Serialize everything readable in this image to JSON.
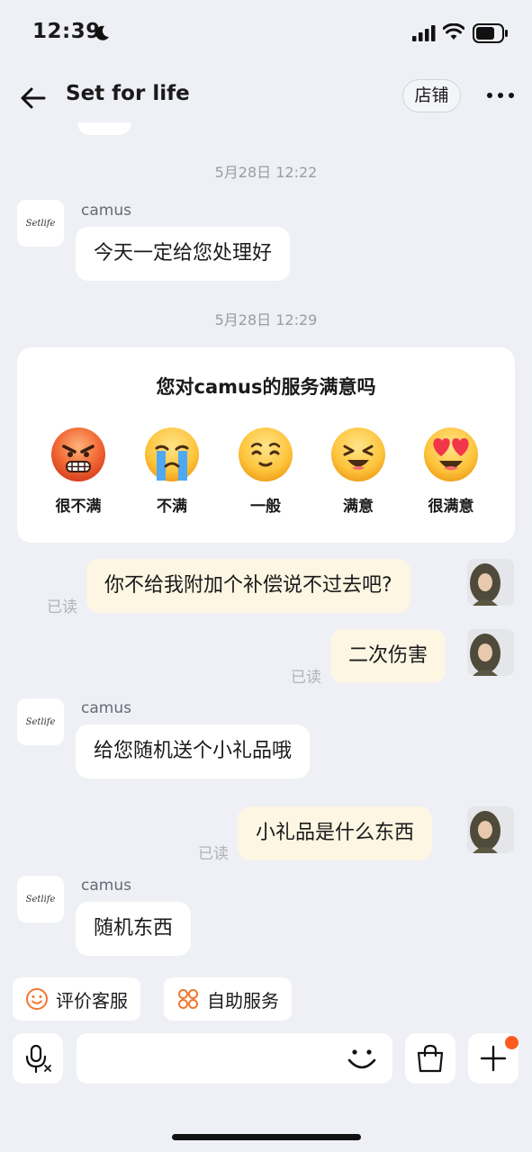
{
  "status_bar": {
    "time": "12:39"
  },
  "header": {
    "title": "Set for life",
    "store_label": "店铺"
  },
  "messages": [
    {
      "type": "time",
      "text": "5月28日 12:22"
    },
    {
      "type": "incoming",
      "sender": "camus",
      "text": "今天一定给您处理好"
    },
    {
      "type": "time",
      "text": "5月28日 12:29"
    },
    {
      "type": "outgoing",
      "text": "你不给我附加个补偿说不过去吧?",
      "status": "已读"
    },
    {
      "type": "outgoing",
      "text": "二次伤害",
      "status": "已读"
    },
    {
      "type": "incoming",
      "sender": "camus",
      "text": "给您随机送个小礼品哦"
    },
    {
      "type": "outgoing",
      "text": "小礼品是什么东西",
      "status": "已读"
    },
    {
      "type": "incoming",
      "sender": "camus",
      "text": "随机东西"
    }
  ],
  "survey": {
    "title": "您对camus的服务满意吗",
    "options": [
      {
        "label": "很不满",
        "icon": "angry-face-icon"
      },
      {
        "label": "不满",
        "icon": "crying-face-icon"
      },
      {
        "label": "一般",
        "icon": "neutral-face-icon"
      },
      {
        "label": "满意",
        "icon": "happy-face-icon"
      },
      {
        "label": "很满意",
        "icon": "heart-eyes-face-icon"
      }
    ]
  },
  "quick_actions": [
    {
      "label": "评价客服",
      "icon": "smile-icon"
    },
    {
      "label": "自助服务",
      "icon": "grid-icon"
    }
  ],
  "input": {
    "placeholder": ""
  },
  "logo_text": "Setlife",
  "colors": {
    "incoming_bubble": "#ffffff",
    "outgoing_bubble": "#fdf6e3",
    "background": "#eef0f6",
    "accent": "#ff5a1f"
  }
}
